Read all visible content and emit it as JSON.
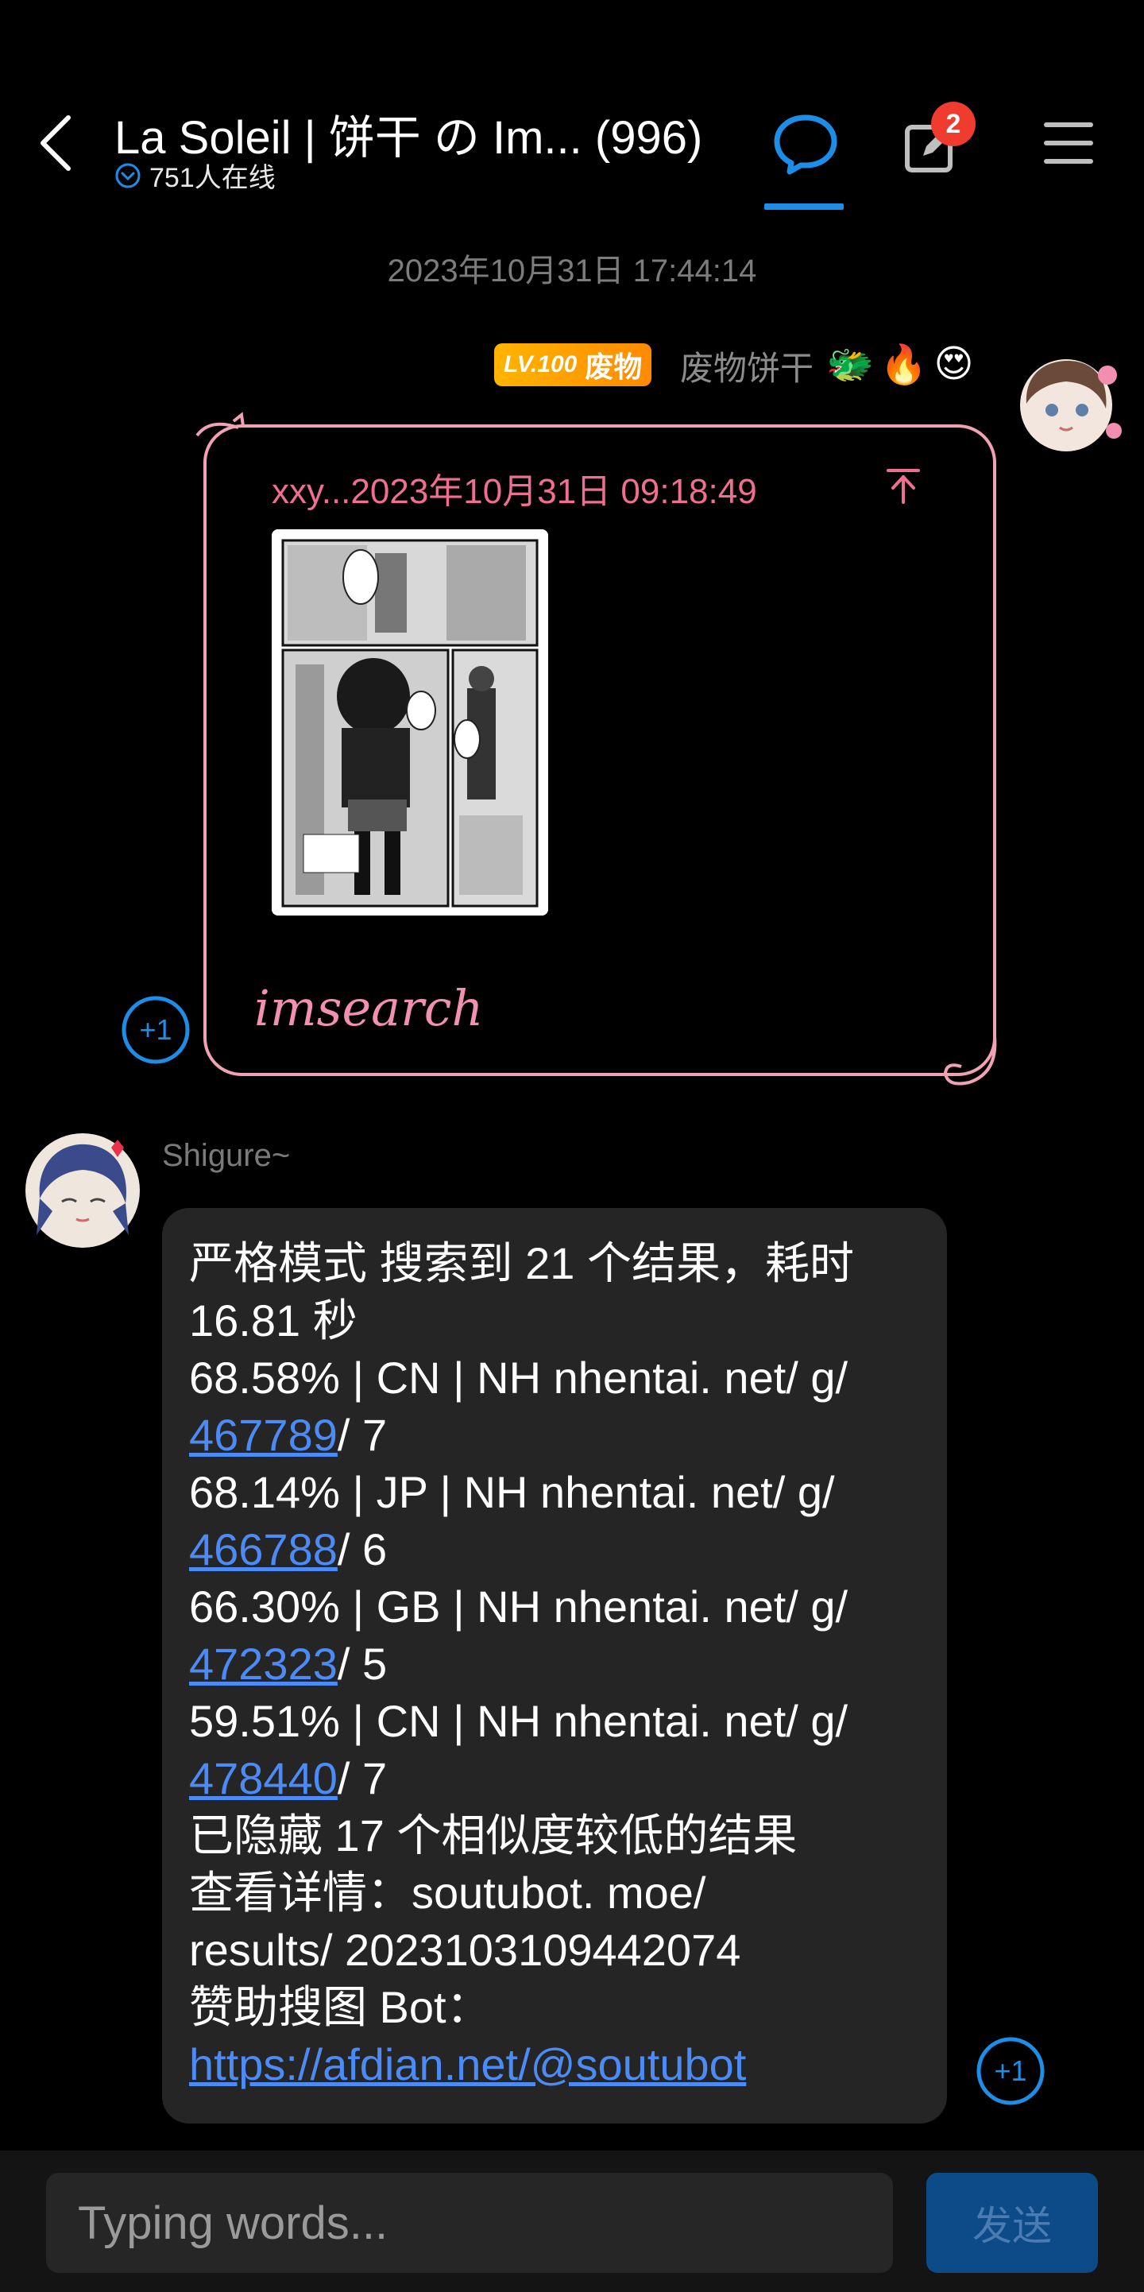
{
  "header": {
    "title": "La Soleil | 饼干 の Im... (996)",
    "online": "751人在线",
    "notification_count": "2",
    "icons": [
      "back-icon",
      "chat-icon",
      "edit-icon",
      "menu-icon",
      "chevron-down-circle-icon"
    ]
  },
  "timestamp": "2023年10月31日 17:44:14",
  "my_message": {
    "level": "LV.100",
    "level_tag": "废物",
    "name": "废物饼干",
    "emojis": [
      "🐲",
      "🔥",
      "😍"
    ],
    "reply_meta": "xxy...2023年10月31日 09:18:49",
    "text": "imsearch",
    "plus_one": "+1"
  },
  "bot_message": {
    "name": "Shigure~",
    "lines": [
      {
        "text": "严格模式 搜索到 21 个结果，耗时"
      },
      {
        "text": "16.81 秒"
      },
      {
        "text": "68.58% | CN | NH nhentai. net/ g/"
      },
      {
        "link": "467789",
        "after": "/ 7"
      },
      {
        "text": "68.14% | JP | NH nhentai. net/ g/"
      },
      {
        "link": "466788",
        "after": "/ 6"
      },
      {
        "text": "66.30% | GB | NH nhentai. net/ g/"
      },
      {
        "link": "472323",
        "after": "/ 5"
      },
      {
        "text": "59.51% | CN | NH nhentai. net/ g/"
      },
      {
        "link": "478440",
        "after": "/ 7"
      },
      {
        "text": "已隐藏 17 个相似度较低的结果"
      },
      {
        "text": "查看详情：soutubot. moe/"
      },
      {
        "text": "results/ 2023103109442074"
      },
      {
        "text": "赞助搜图 Bot："
      },
      {
        "link": "https://afdian.net/@soutubot",
        "after": ""
      }
    ],
    "plus_one": "+1"
  },
  "input": {
    "placeholder": "Typing words...",
    "send_label": "发送"
  },
  "colors": {
    "accent": "#1d8ee8",
    "bubble_border": "#f0a2b4",
    "link": "#4c8bf5",
    "badge": "#f03c2e"
  }
}
